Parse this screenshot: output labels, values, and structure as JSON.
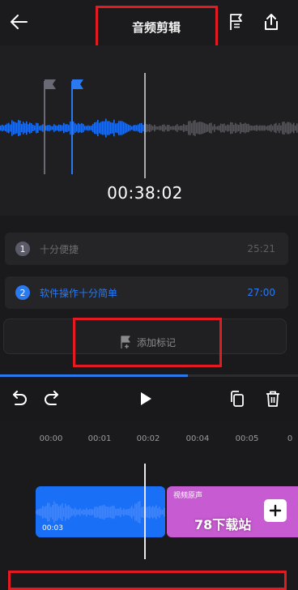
{
  "header": {
    "title": "音频剪辑",
    "back_icon": "arrow-left-icon",
    "flag_icon": "flag-list-icon",
    "share_icon": "share-upload-icon"
  },
  "player": {
    "current_time": "00:38:02"
  },
  "markers": [
    {
      "index": "1",
      "label": "十分便捷",
      "time": "25:21",
      "active": false
    },
    {
      "index": "2",
      "label": "软件操作十分简单",
      "time": "27:00",
      "active": true
    }
  ],
  "add_marker": {
    "label": "添加标记",
    "icon": "flag-plus-icon"
  },
  "progress": {
    "fraction": 0.63
  },
  "toolbar": {
    "undo_icon": "undo-icon",
    "redo_icon": "redo-icon",
    "play_icon": "play-icon",
    "copy_icon": "copy-icon",
    "delete_icon": "trash-icon"
  },
  "timeline": {
    "ticks": [
      "00:00",
      "00:01",
      "00:02",
      "00:04",
      "00:05",
      "0"
    ],
    "clip_blue": {
      "duration": "00:03"
    },
    "clip_pink": {
      "label": "视频原声"
    },
    "add_icon": "plus-icon"
  },
  "watermark": "78下载站",
  "colors": {
    "accent": "#2b79f0",
    "clip_pink": "#c75bd1",
    "highlight_box": "#e21a22"
  }
}
